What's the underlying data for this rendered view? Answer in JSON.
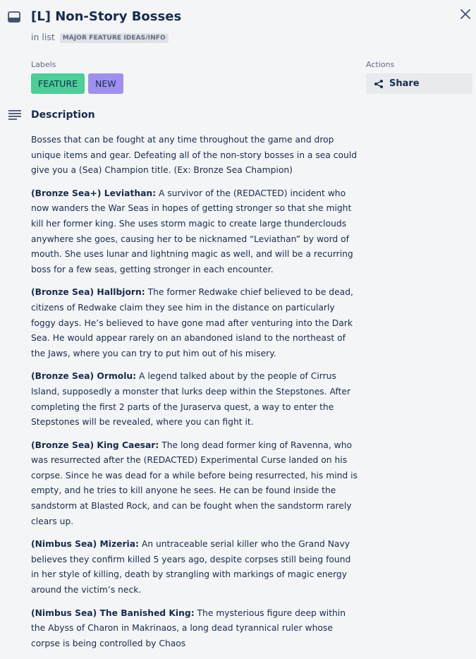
{
  "card": {
    "title": "[L] Non-Story Bosses",
    "in_list_prefix": "in list",
    "list_name": "MAJOR FEATURE IDEAS/INFO"
  },
  "labels": {
    "heading": "Labels",
    "items": [
      {
        "text": "FEATURE",
        "color": "#4bce97"
      },
      {
        "text": "NEW",
        "color": "#9f8fef"
      }
    ]
  },
  "actions": {
    "heading": "Actions",
    "share_label": "Share"
  },
  "description": {
    "heading": "Description",
    "paragraphs": [
      {
        "bold": "",
        "text": "Bosses that can be fought at any time throughout the game and drop unique items and gear. Defeating all of the non-story bosses in a sea could give you a (Sea) Champion title. (Ex: Bronze Sea Champion)"
      },
      {
        "bold": "(Bronze Sea+) Leviathan:",
        "text": " A survivor of the (REDACTED) incident who now wanders the War Seas in hopes of getting stronger so that she might kill her former king. She uses storm magic to create large thunderclouds anywhere she goes, causing her to be nicknamed “Leviathan” by word of mouth. She uses lunar and lightning magic as well, and will be a recurring boss for a few seas, getting stronger in each encounter."
      },
      {
        "bold": "(Bronze Sea) Hallbjorn:",
        "text": " The former Redwake chief believed to be dead, citizens of Redwake claim they see him in the distance on particularly foggy days. He’s believed to have gone mad after venturing into the Dark Sea. He would appear rarely on an abandoned island to the northeast of the Jaws, where you can try to put him out of his misery."
      },
      {
        "bold": "(Bronze Sea) Ormolu:",
        "text": " A legend talked about by the people of Cirrus Island, supposedly a monster that lurks deep within the Stepstones. After completing the first 2 parts of the Juraserva quest, a way to enter the Stepstones will be revealed, where you can fight it."
      },
      {
        "bold": "(Bronze Sea) King Caesar:",
        "text": " The long dead former king of Ravenna, who was resurrected after the (REDACTED) Experimental Curse landed on his corpse. Since he was dead for a while before being resurrected, his mind is empty, and he tries to kill anyone he sees. He can be found inside the sandstorm at Blasted Rock, and can be fought when the sandstorm rarely clears up."
      },
      {
        "bold": "(Nimbus Sea) Mizeria:",
        "text": " An untraceable serial killer who the Grand Navy believes they confirm killed 5 years ago, despite corpses still being found in her style of killing, death by strangling with markings of magic energy around the victim’s neck."
      },
      {
        "bold": "(Nimbus Sea) The Banished King:",
        "text": " The mysterious figure deep within the Abyss of Charon in Makrinaos, a long dead tyrannical ruler whose corpse is being controlled by Chaos"
      }
    ]
  }
}
